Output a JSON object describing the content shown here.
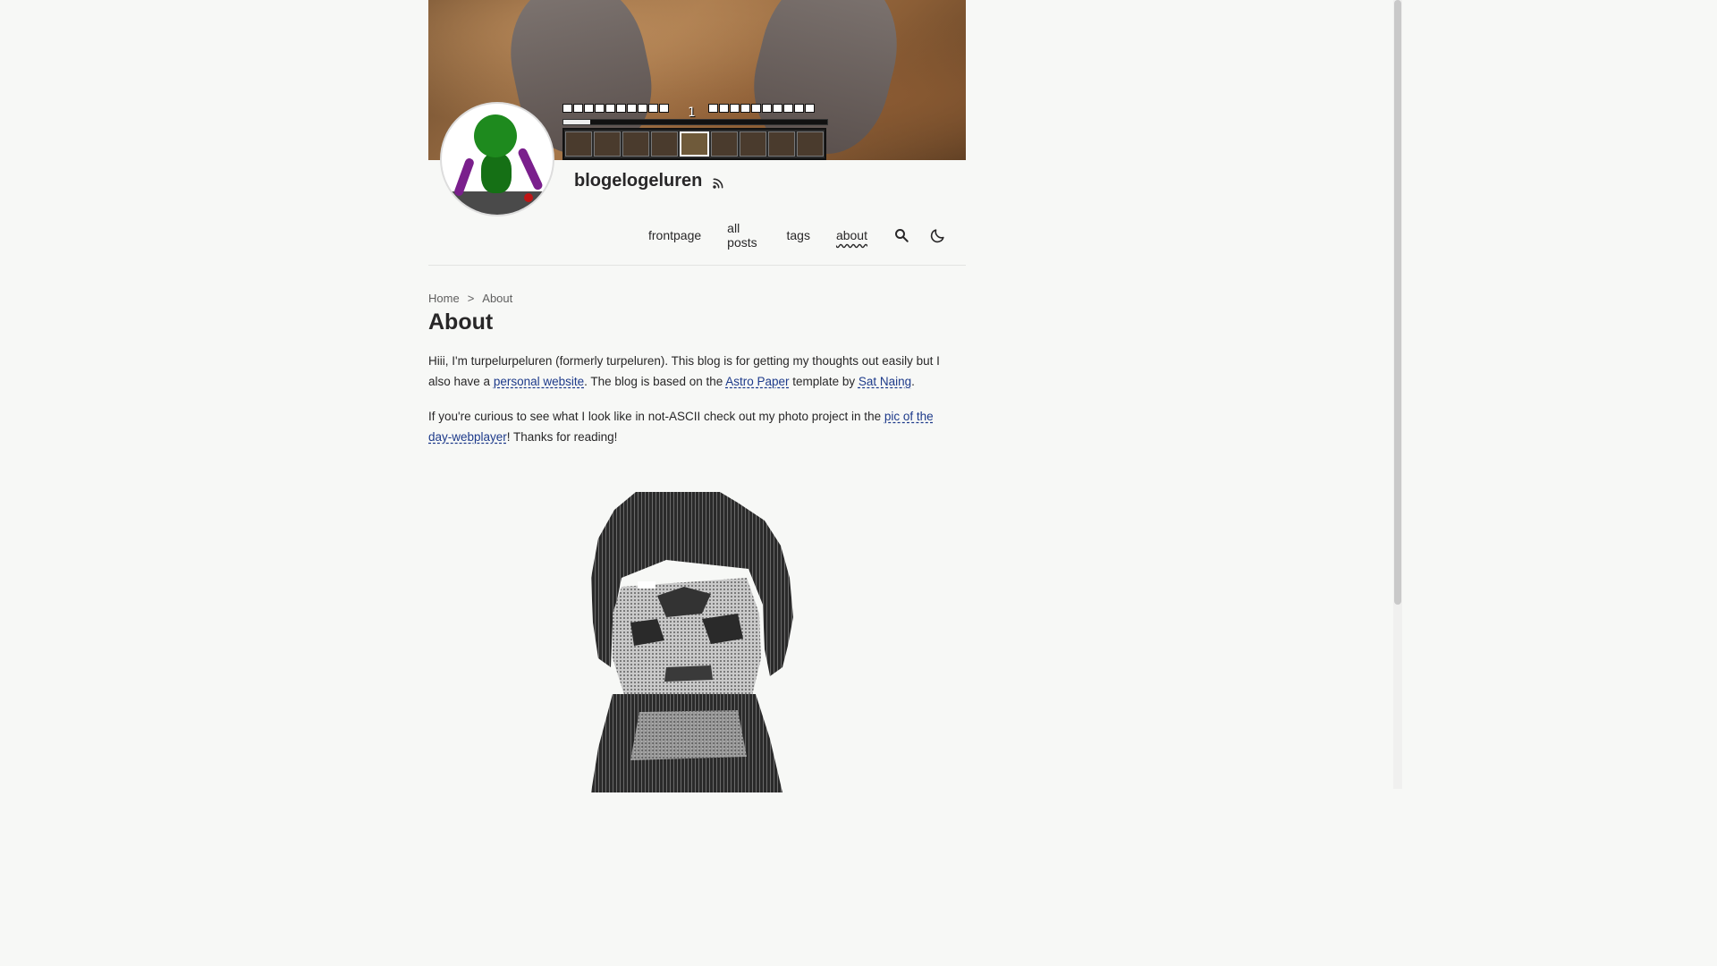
{
  "header": {
    "site_title": "blogelogeluren",
    "rss_icon": "rss-icon",
    "banner": {
      "hud_level": "1"
    }
  },
  "nav": {
    "items": [
      {
        "label": "frontpage"
      },
      {
        "label": "all posts"
      },
      {
        "label": "tags"
      },
      {
        "label": "about",
        "active": true
      }
    ],
    "search_icon": "search-icon",
    "theme_icon": "moon-icon"
  },
  "breadcrumb": {
    "home": "Home",
    "separator": ">",
    "current": "About"
  },
  "page": {
    "title": "About",
    "p1_a": "Hiii, I'm turpelurpeluren (formerly turpeluren). This blog is for getting my thoughts out easily but I also have a ",
    "p1_link1": "personal website",
    "p1_b": ". The blog is based on the ",
    "p1_link2": "Astro Paper",
    "p1_c": " template by ",
    "p1_link3": "Sat Naing",
    "p1_d": ".",
    "p2_a": "If you're curious to see what I look like in not-ASCII check out my photo project in the ",
    "p2_link": "pic of the day-webplayer",
    "p2_b": "! Thanks for reading!"
  },
  "colors": {
    "background": "#f7f8f6",
    "text": "#282728",
    "link": "#1d3a8a"
  }
}
